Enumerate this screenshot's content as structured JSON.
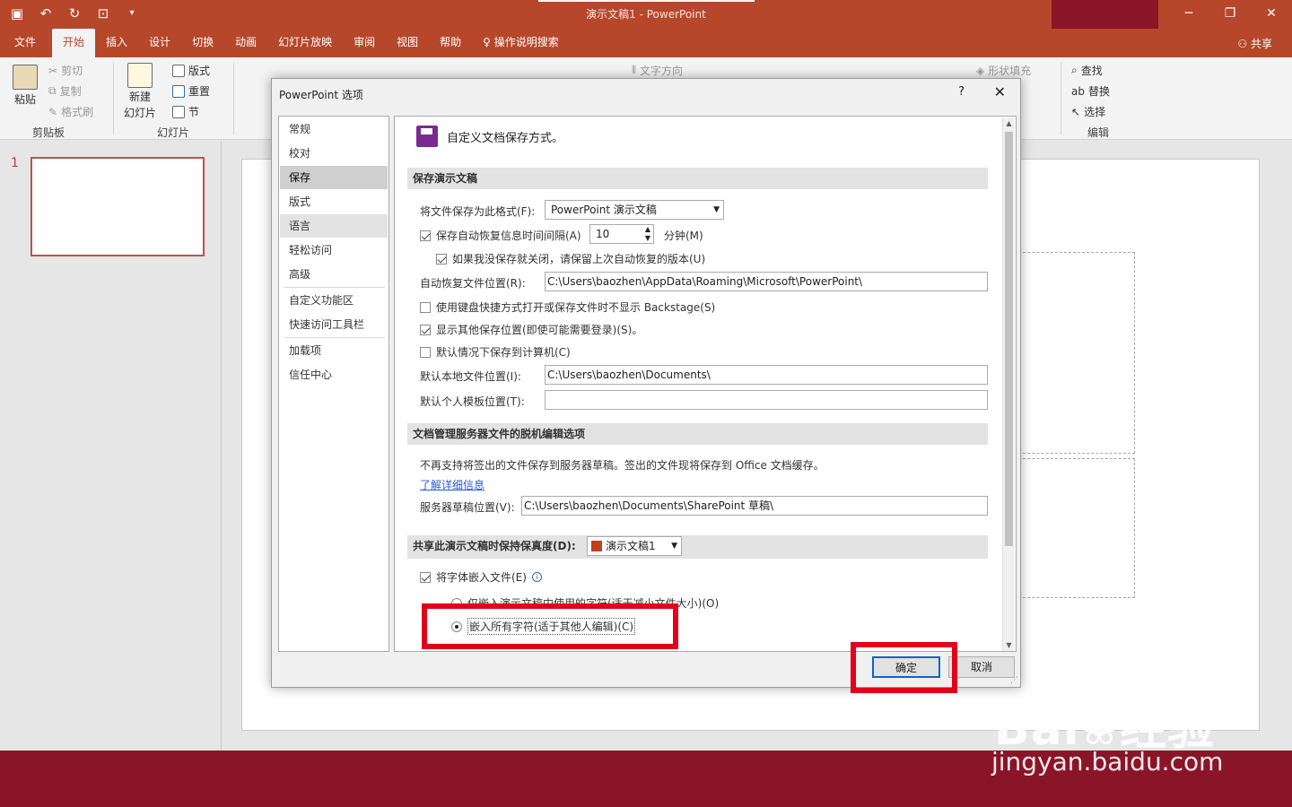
{
  "window": {
    "title": "演示文稿1  -  PowerPoint",
    "qat_icons": [
      "save-icon",
      "undo-icon",
      "redo-icon",
      "presentation-icon",
      "customize-icon"
    ],
    "controls": [
      "─",
      "❐",
      "✕"
    ]
  },
  "ribbon_tabs": [
    "文件",
    "开始",
    "插入",
    "设计",
    "切换",
    "动画",
    "幻灯片放映",
    "审阅",
    "视图",
    "帮助",
    "操作说明搜索"
  ],
  "share_label": "共享",
  "ribbon": {
    "paste": "粘贴",
    "cut": "剪切",
    "copy": "复制",
    "format_painter": "格式刷",
    "clipboard_group": "剪贴板",
    "new_slide": "新建",
    "new_slide2": "幻灯片",
    "layout": "版式",
    "reset": "重置",
    "section": "节",
    "slides_group": "幻灯片",
    "text_direction": "文字方向",
    "shape_fill": "形状填充",
    "find": "查找",
    "replace": "替换",
    "select": "选择",
    "editing_group": "编辑"
  },
  "thumbnail": {
    "slide_number": "1"
  },
  "dialog": {
    "title": "PowerPoint 选项",
    "help": "?",
    "close": "✕",
    "nav": [
      "常规",
      "校对",
      "保存",
      "版式",
      "语言",
      "轻松访问",
      "高级",
      "自定义功能区",
      "快速访问工具栏",
      "加载项",
      "信任中心"
    ],
    "nav_selected": "保存",
    "header": "自定义文档保存方式。",
    "section_save": "保存演示文稿",
    "format_label": "将文件保存为此格式(F):",
    "format_value": "PowerPoint 演示文稿",
    "autorecover_label": "保存自动恢复信息时间间隔(A)",
    "autorecover_value": "10",
    "minutes_label": "分钟(M)",
    "keep_last_label": "如果我没保存就关闭，请保留上次自动恢复的版本(U)",
    "autorecover_location_label": "自动恢复文件位置(R):",
    "autorecover_location_value": "C:\\Users\\baozhen\\AppData\\Roaming\\Microsoft\\PowerPoint\\",
    "no_backstage_label": "使用键盘快捷方式打开或保存文件时不显示 Backstage(S)",
    "show_other_label": "显示其他保存位置(即使可能需要登录)(S)。",
    "save_computer_label": "默认情况下保存到计算机(C)",
    "local_location_label": "默认本地文件位置(I):",
    "local_location_value": "C:\\Users\\baozhen\\Documents\\",
    "template_location_label": "默认个人模板位置(T):",
    "template_location_value": "",
    "section_offline": "文档管理服务器文件的脱机编辑选项",
    "offline_note": "不再支持将签出的文件保存到服务器草稿。签出的文件现将保存到 Office 文档缓存。",
    "learn_more": "了解详细信息",
    "server_drafts_label": "服务器草稿位置(V):",
    "server_drafts_value": "C:\\Users\\baozhen\\Documents\\SharePoint 草稿\\",
    "section_fidelity": "共享此演示文稿时保持保真度(D):",
    "fidelity_doc": "演示文稿1",
    "embed_fonts_label": "将字体嵌入文件(E)",
    "embed_used_label": "仅嵌入演示文稿中使用的字符(适于减小文件大小)(O)",
    "embed_all_label": "嵌入所有字符(适于其他人编辑)(C)",
    "ok": "确定",
    "cancel": "取消"
  },
  "watermark": {
    "brand": "Bai",
    "brand2": "经验",
    "url": "jingyan.baidu.com"
  },
  "colors": {
    "accent": "#b7472a",
    "highlight": "#e3001b",
    "status": "#8b1528"
  }
}
